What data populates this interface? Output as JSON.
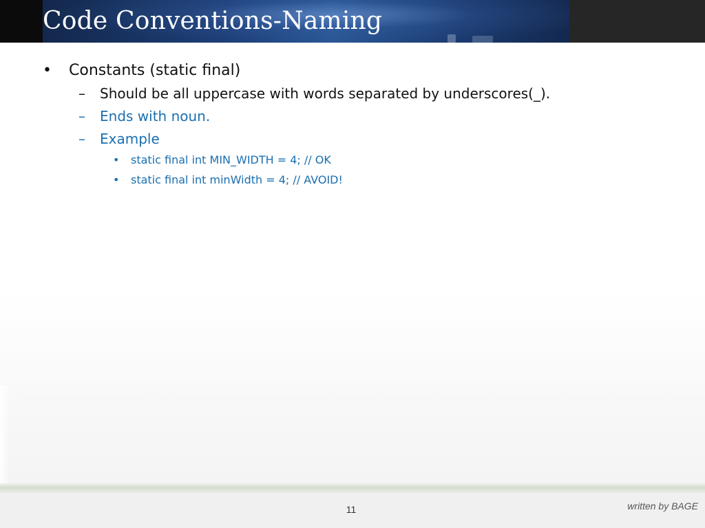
{
  "slide": {
    "title": "Code Conventions-Naming",
    "page_number": "11",
    "credit": "written by BAGE"
  },
  "bullets": {
    "level1": {
      "marker": "•",
      "text": "Constants (static final)"
    },
    "level2": [
      {
        "marker": "–",
        "text": "Should be all uppercase with words separated by underscores(_)."
      },
      {
        "marker": "–",
        "text": "Ends with noun."
      },
      {
        "marker": "–",
        "text": "Example"
      }
    ],
    "level3": [
      {
        "marker": "•",
        "text": "static final int MIN_WIDTH = 4; // OK"
      },
      {
        "marker": "•",
        "text": "static final int minWidth = 4; // AVOID!"
      }
    ]
  },
  "colors": {
    "primary_text": "#111111",
    "accent_text": "#1a6fb0",
    "header_blue": "#1d3f78",
    "footer_bg": "#f0f0f0"
  }
}
